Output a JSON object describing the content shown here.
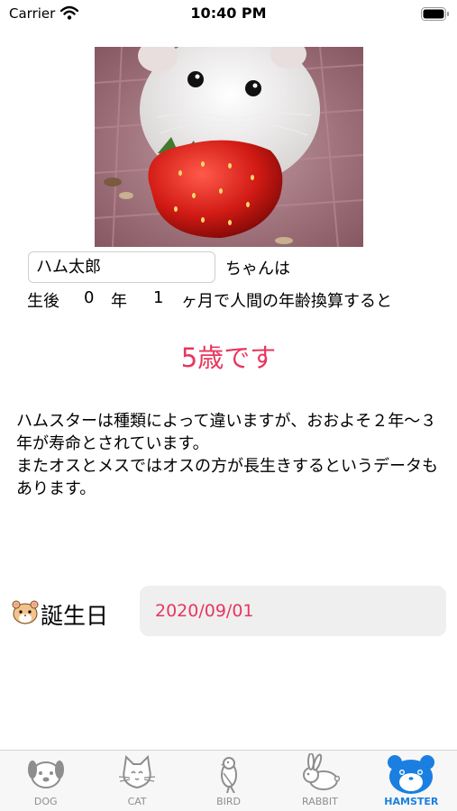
{
  "status_bar": {
    "carrier": "Carrier",
    "time": "10:40 PM"
  },
  "pet": {
    "name": "ハム太郎",
    "name_suffix": "ちゃんは"
  },
  "age": {
    "prefix": "生後",
    "years": "0",
    "year_unit": "年",
    "months": "1",
    "suffix": "ヶ月で人間の年齢換算すると"
  },
  "result": "5歳です",
  "description": "ハムスターは種類によって違いますが、おおよそ２年〜３年が寿命とされています。\nまたオスとメスではオスの方が長生きするというデータもあります。",
  "birthday": {
    "label": "誕生日",
    "date": "2020/09/01"
  },
  "colors": {
    "accent": "#e8365f",
    "tab_active": "#1a7fe0",
    "tab_inactive": "#8e8e8e"
  },
  "tabs": [
    {
      "label": "DOG",
      "icon": "dog-icon",
      "active": false
    },
    {
      "label": "CAT",
      "icon": "cat-icon",
      "active": false
    },
    {
      "label": "BIRD",
      "icon": "bird-icon",
      "active": false
    },
    {
      "label": "RABBIT",
      "icon": "rabbit-icon",
      "active": false
    },
    {
      "label": "HAMSTER",
      "icon": "hamster-icon",
      "active": true
    }
  ]
}
